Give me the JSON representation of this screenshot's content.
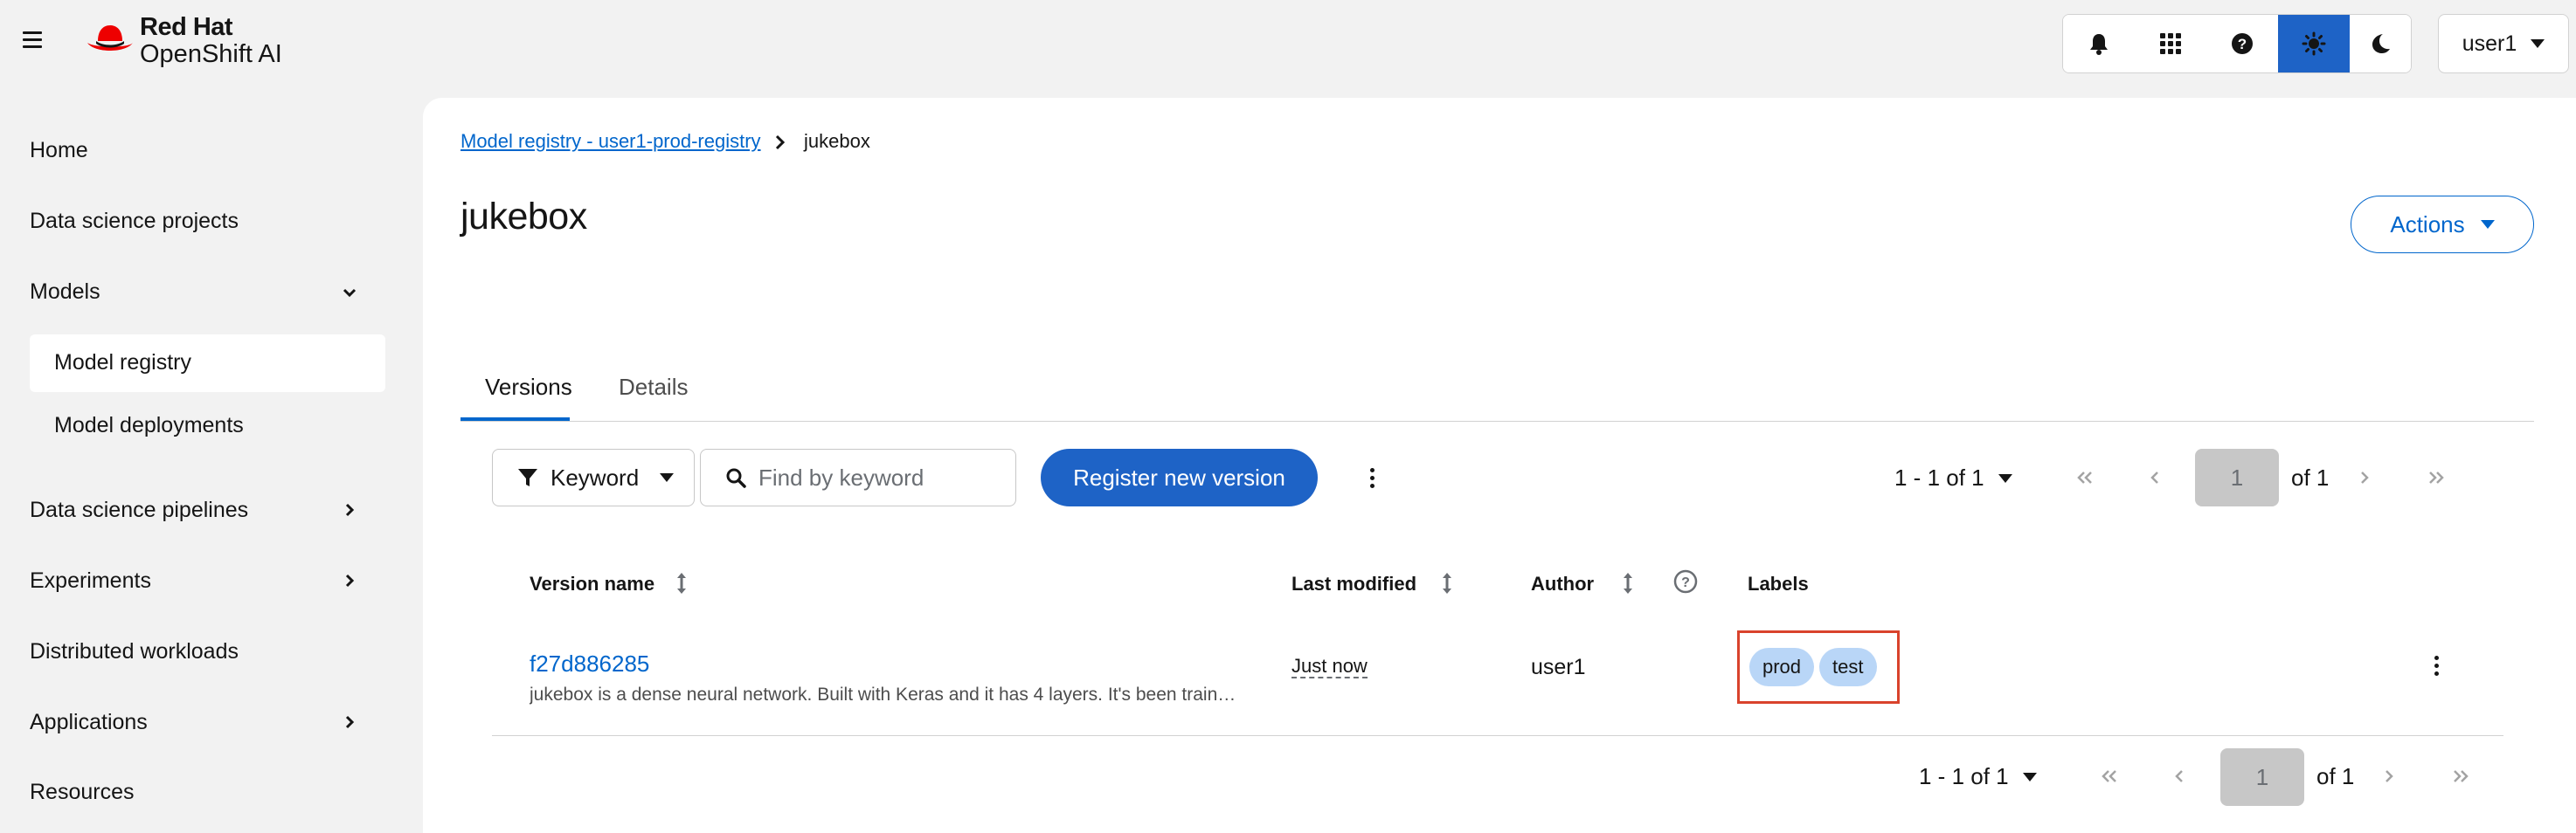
{
  "header": {
    "brand_line1": "Red Hat",
    "brand_line2": "OpenShift AI",
    "user": "user1",
    "colors": {
      "brand_red": "#ee0000",
      "accent_blue": "#1e63c6"
    },
    "icons": [
      "menu-icon",
      "bell-icon",
      "app-grid-icon",
      "help-icon",
      "sun-icon",
      "moon-icon",
      "caret-down-icon"
    ]
  },
  "sidebar": {
    "home": "Home",
    "data_science_projects": "Data science projects",
    "models": "Models",
    "model_registry": "Model registry",
    "model_deployments": "Model deployments",
    "data_science_pipelines": "Data science pipelines",
    "experiments": "Experiments",
    "distributed_workloads": "Distributed workloads",
    "applications": "Applications",
    "resources": "Resources"
  },
  "breadcrumb": {
    "parent": "Model registry - user1-prod-registry",
    "current": "jukebox"
  },
  "page": {
    "title": "jukebox",
    "actions_label": "Actions"
  },
  "tabs": {
    "versions": "Versions",
    "details": "Details"
  },
  "toolbar": {
    "filter_label": "Keyword",
    "search_placeholder": "Find by keyword",
    "register_label": "Register new version"
  },
  "pagination": {
    "count": "1 - 1 of 1",
    "page": "1",
    "of": "of 1"
  },
  "table": {
    "headers": {
      "version_name": "Version name",
      "last_modified": "Last modified",
      "author": "Author",
      "labels": "Labels"
    },
    "rows": [
      {
        "version": "f27d886285",
        "description": "jukebox is a dense neural network. Built with Keras and it has 4 layers. It's been trained…",
        "last_modified": "Just now",
        "author": "user1",
        "labels": [
          "prod",
          "test"
        ]
      }
    ]
  }
}
